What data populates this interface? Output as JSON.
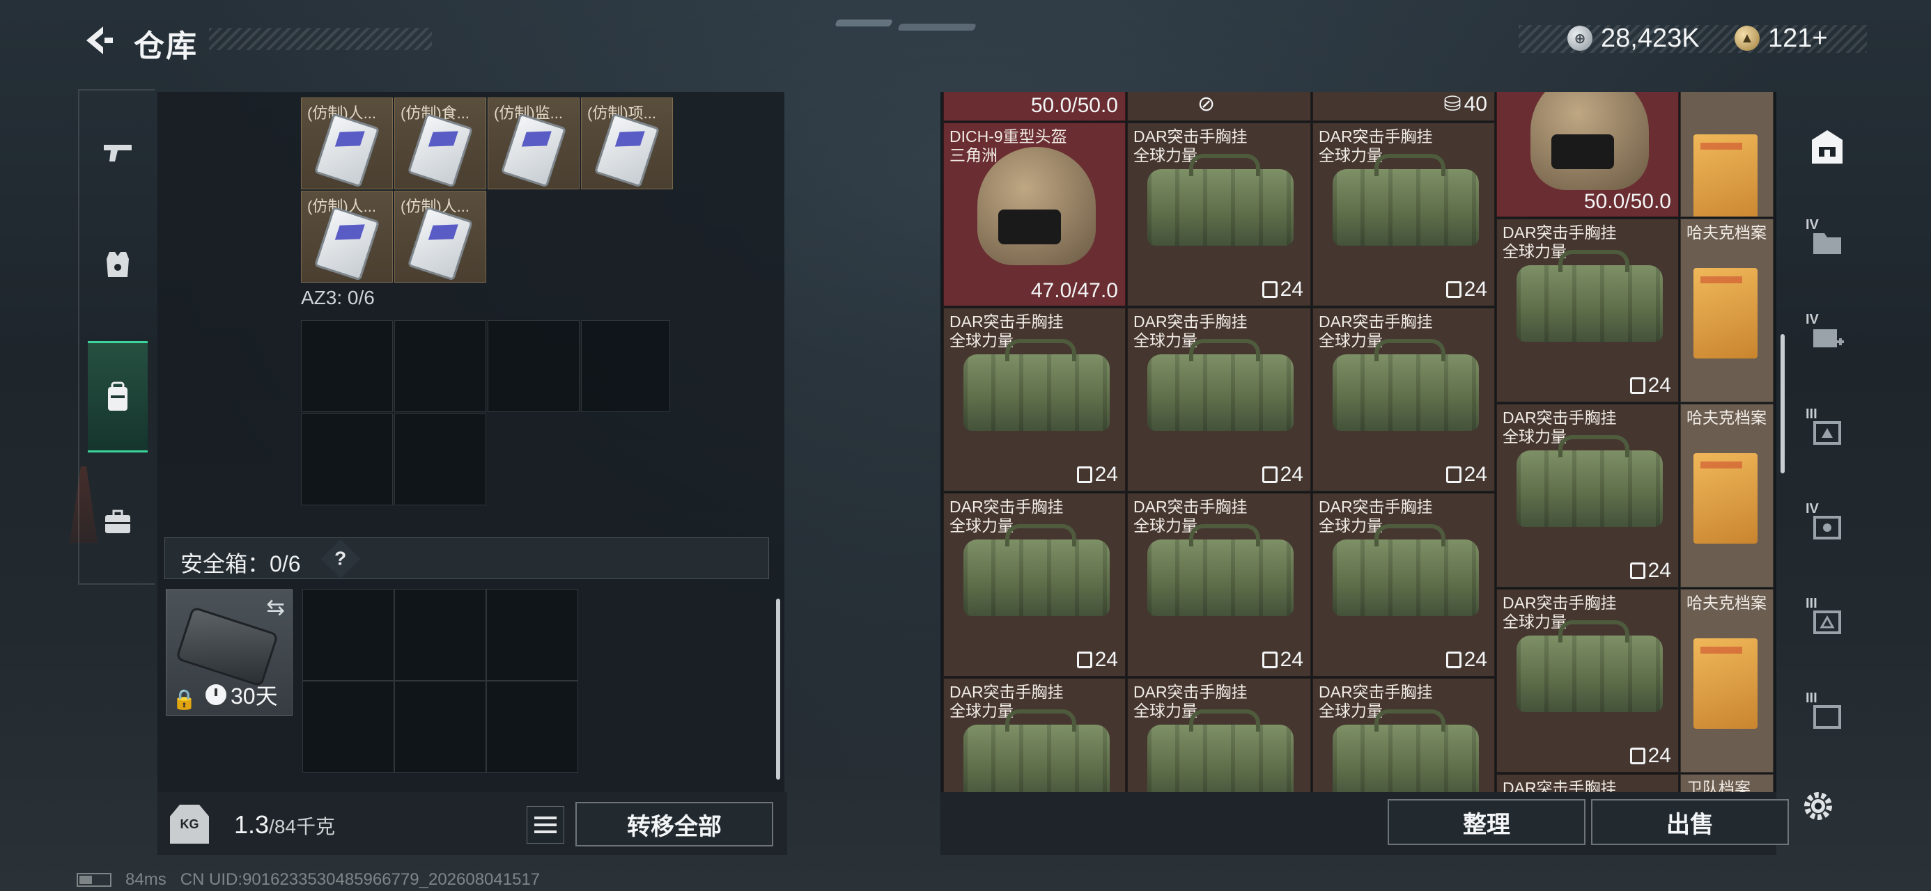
{
  "header": {
    "title": "仓库",
    "currency_silver": "28,423K",
    "currency_gold": "121+"
  },
  "left_nav": [
    {
      "id": "weapons",
      "icon": "pistol-icon"
    },
    {
      "id": "armor",
      "icon": "vest-icon"
    },
    {
      "id": "backpack",
      "icon": "backpack-icon",
      "active": true
    },
    {
      "id": "case",
      "icon": "briefcase-icon"
    }
  ],
  "left_panel": {
    "items": [
      {
        "label": "(仿制)人..."
      },
      {
        "label": "(仿制)食..."
      },
      {
        "label": "(仿制)监..."
      },
      {
        "label": "(仿制)项..."
      },
      {
        "label": "(仿制)人..."
      },
      {
        "label": "(仿制)人..."
      }
    ],
    "az3_label": "AZ3: 0/6",
    "safe_box_label": "安全箱：0/6",
    "help": "?",
    "safe_box_days": "30天"
  },
  "bottom_left": {
    "kg": "KG",
    "weight_current": "1.3",
    "weight_max": "/84千克",
    "transfer_all": "转移全部"
  },
  "right_grid": {
    "top_row": {
      "dur_left": "50.0/50.0",
      "count_mid": "40"
    },
    "helmet": {
      "name": "DICH-9重型头盔\n三角洲",
      "durability": "47.0/47.0"
    },
    "right_top_helmet": {
      "durability": "50.0/50.0"
    },
    "bag_name": "DAR突击手胸挂\n全球力量",
    "bag_count": "24",
    "file_name": "哈夫克档案",
    "bottom_partial_left": "DAR突击手胸挂",
    "bottom_partial_right": "卫队档案"
  },
  "right_bottom": {
    "sort": "整理",
    "sell": "出售"
  },
  "right_nav": [
    {
      "tier": "",
      "icon": "home-icon"
    },
    {
      "tier": "IV",
      "icon": "folder-icon"
    },
    {
      "tier": "IV",
      "icon": "medkit-plus-icon"
    },
    {
      "tier": "III",
      "icon": "ammo-crate-icon"
    },
    {
      "tier": "IV",
      "icon": "crate-tools-icon"
    },
    {
      "tier": "III",
      "icon": "crate-icon"
    },
    {
      "tier": "III",
      "icon": "crate-icon"
    }
  ],
  "footer": {
    "ping": "84ms",
    "uid": "CN UID:9016233530485966779_202608041517"
  },
  "colors": {
    "accent_green": "#3bd49a",
    "bag_cell": "#45362f",
    "helmet_cell": "#6a2d31",
    "file_cell": "#6b5d50"
  }
}
